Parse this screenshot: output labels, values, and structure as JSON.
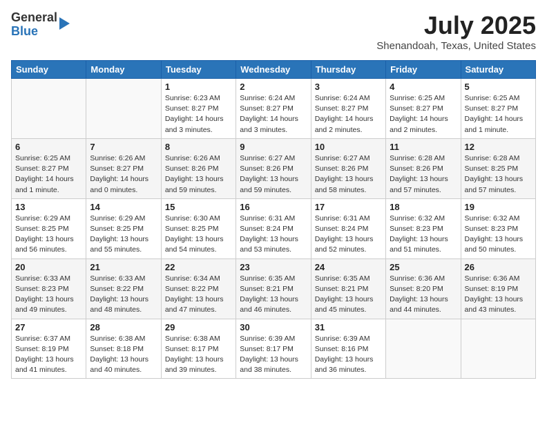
{
  "header": {
    "logo_general": "General",
    "logo_blue": "Blue",
    "month_year": "July 2025",
    "location": "Shenandoah, Texas, United States"
  },
  "days_of_week": [
    "Sunday",
    "Monday",
    "Tuesday",
    "Wednesday",
    "Thursday",
    "Friday",
    "Saturday"
  ],
  "weeks": [
    {
      "days": [
        {
          "number": "",
          "info": ""
        },
        {
          "number": "",
          "info": ""
        },
        {
          "number": "1",
          "info": "Sunrise: 6:23 AM\nSunset: 8:27 PM\nDaylight: 14 hours\nand 3 minutes."
        },
        {
          "number": "2",
          "info": "Sunrise: 6:24 AM\nSunset: 8:27 PM\nDaylight: 14 hours\nand 3 minutes."
        },
        {
          "number": "3",
          "info": "Sunrise: 6:24 AM\nSunset: 8:27 PM\nDaylight: 14 hours\nand 2 minutes."
        },
        {
          "number": "4",
          "info": "Sunrise: 6:25 AM\nSunset: 8:27 PM\nDaylight: 14 hours\nand 2 minutes."
        },
        {
          "number": "5",
          "info": "Sunrise: 6:25 AM\nSunset: 8:27 PM\nDaylight: 14 hours\nand 1 minute."
        }
      ]
    },
    {
      "days": [
        {
          "number": "6",
          "info": "Sunrise: 6:25 AM\nSunset: 8:27 PM\nDaylight: 14 hours\nand 1 minute."
        },
        {
          "number": "7",
          "info": "Sunrise: 6:26 AM\nSunset: 8:27 PM\nDaylight: 14 hours\nand 0 minutes."
        },
        {
          "number": "8",
          "info": "Sunrise: 6:26 AM\nSunset: 8:26 PM\nDaylight: 13 hours\nand 59 minutes."
        },
        {
          "number": "9",
          "info": "Sunrise: 6:27 AM\nSunset: 8:26 PM\nDaylight: 13 hours\nand 59 minutes."
        },
        {
          "number": "10",
          "info": "Sunrise: 6:27 AM\nSunset: 8:26 PM\nDaylight: 13 hours\nand 58 minutes."
        },
        {
          "number": "11",
          "info": "Sunrise: 6:28 AM\nSunset: 8:26 PM\nDaylight: 13 hours\nand 57 minutes."
        },
        {
          "number": "12",
          "info": "Sunrise: 6:28 AM\nSunset: 8:25 PM\nDaylight: 13 hours\nand 57 minutes."
        }
      ]
    },
    {
      "days": [
        {
          "number": "13",
          "info": "Sunrise: 6:29 AM\nSunset: 8:25 PM\nDaylight: 13 hours\nand 56 minutes."
        },
        {
          "number": "14",
          "info": "Sunrise: 6:29 AM\nSunset: 8:25 PM\nDaylight: 13 hours\nand 55 minutes."
        },
        {
          "number": "15",
          "info": "Sunrise: 6:30 AM\nSunset: 8:25 PM\nDaylight: 13 hours\nand 54 minutes."
        },
        {
          "number": "16",
          "info": "Sunrise: 6:31 AM\nSunset: 8:24 PM\nDaylight: 13 hours\nand 53 minutes."
        },
        {
          "number": "17",
          "info": "Sunrise: 6:31 AM\nSunset: 8:24 PM\nDaylight: 13 hours\nand 52 minutes."
        },
        {
          "number": "18",
          "info": "Sunrise: 6:32 AM\nSunset: 8:23 PM\nDaylight: 13 hours\nand 51 minutes."
        },
        {
          "number": "19",
          "info": "Sunrise: 6:32 AM\nSunset: 8:23 PM\nDaylight: 13 hours\nand 50 minutes."
        }
      ]
    },
    {
      "days": [
        {
          "number": "20",
          "info": "Sunrise: 6:33 AM\nSunset: 8:23 PM\nDaylight: 13 hours\nand 49 minutes."
        },
        {
          "number": "21",
          "info": "Sunrise: 6:33 AM\nSunset: 8:22 PM\nDaylight: 13 hours\nand 48 minutes."
        },
        {
          "number": "22",
          "info": "Sunrise: 6:34 AM\nSunset: 8:22 PM\nDaylight: 13 hours\nand 47 minutes."
        },
        {
          "number": "23",
          "info": "Sunrise: 6:35 AM\nSunset: 8:21 PM\nDaylight: 13 hours\nand 46 minutes."
        },
        {
          "number": "24",
          "info": "Sunrise: 6:35 AM\nSunset: 8:21 PM\nDaylight: 13 hours\nand 45 minutes."
        },
        {
          "number": "25",
          "info": "Sunrise: 6:36 AM\nSunset: 8:20 PM\nDaylight: 13 hours\nand 44 minutes."
        },
        {
          "number": "26",
          "info": "Sunrise: 6:36 AM\nSunset: 8:19 PM\nDaylight: 13 hours\nand 43 minutes."
        }
      ]
    },
    {
      "days": [
        {
          "number": "27",
          "info": "Sunrise: 6:37 AM\nSunset: 8:19 PM\nDaylight: 13 hours\nand 41 minutes."
        },
        {
          "number": "28",
          "info": "Sunrise: 6:38 AM\nSunset: 8:18 PM\nDaylight: 13 hours\nand 40 minutes."
        },
        {
          "number": "29",
          "info": "Sunrise: 6:38 AM\nSunset: 8:17 PM\nDaylight: 13 hours\nand 39 minutes."
        },
        {
          "number": "30",
          "info": "Sunrise: 6:39 AM\nSunset: 8:17 PM\nDaylight: 13 hours\nand 38 minutes."
        },
        {
          "number": "31",
          "info": "Sunrise: 6:39 AM\nSunset: 8:16 PM\nDaylight: 13 hours\nand 36 minutes."
        },
        {
          "number": "",
          "info": ""
        },
        {
          "number": "",
          "info": ""
        }
      ]
    }
  ]
}
